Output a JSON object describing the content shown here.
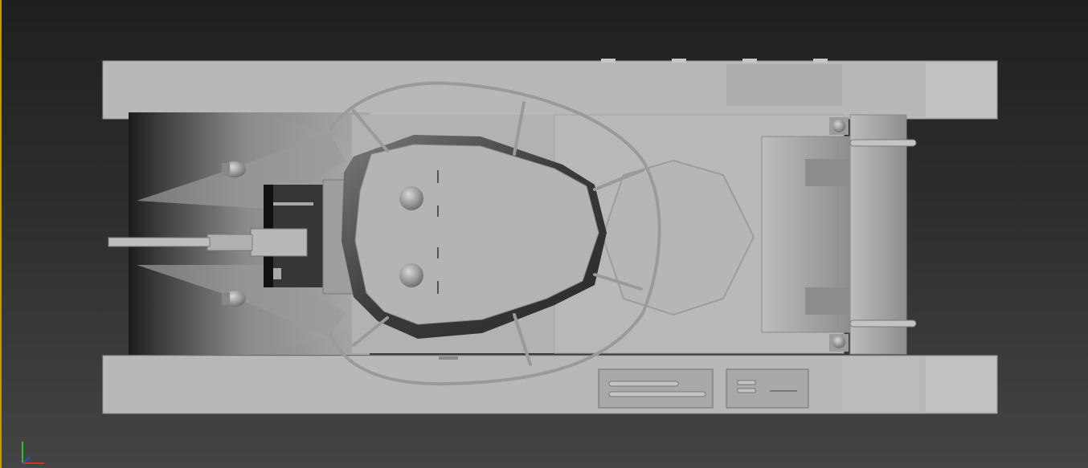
{
  "viewport": {
    "view": "top",
    "shading": "flat grey",
    "background_gradient": [
      "#1f1f1f",
      "#444444"
    ],
    "viewport_border_color": "#b8a000"
  },
  "model": {
    "subject": "tank",
    "body_color": "#b4b4b4",
    "shadow_color": "#3a3a3a"
  },
  "axis_gizmo": {
    "x_color": "#d03030",
    "y_color": "#30c030",
    "z_color": "#3050d0"
  }
}
